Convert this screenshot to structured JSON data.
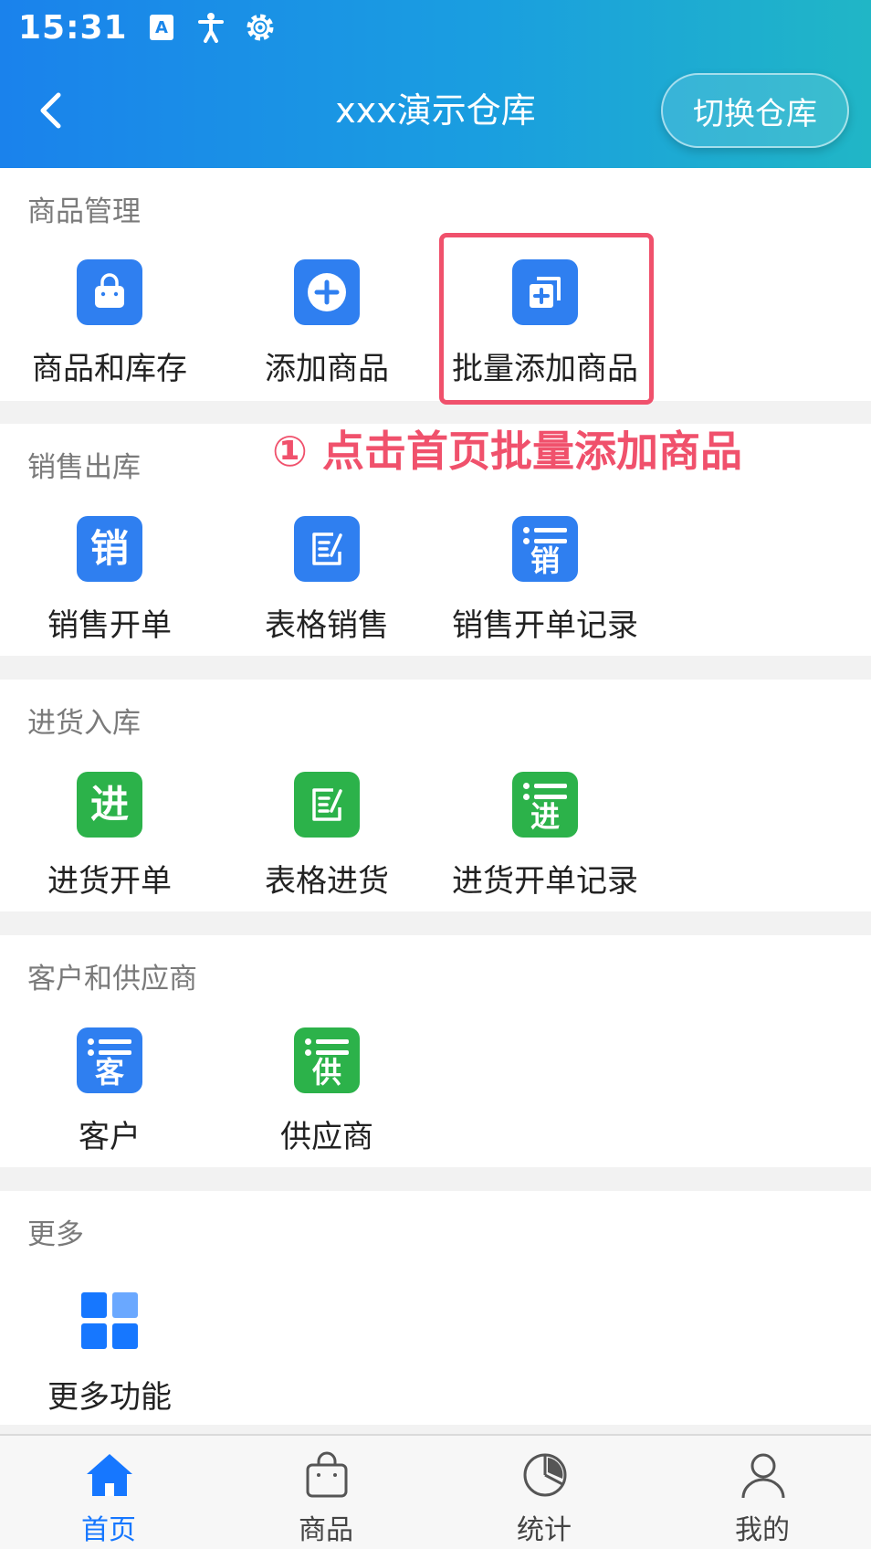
{
  "status_bar": {
    "time": "15:31"
  },
  "header": {
    "title": "xxx演示仓库",
    "switch_label": "切换仓库"
  },
  "sections": [
    {
      "title": "商品管理",
      "items": [
        {
          "label": "商品和库存",
          "icon": "shopping-bag-icon"
        },
        {
          "label": "添加商品",
          "icon": "plus-circle-icon"
        },
        {
          "label": "批量添加商品",
          "icon": "batch-add-icon"
        }
      ]
    },
    {
      "title": "销售出库",
      "items": [
        {
          "label": "销售开单",
          "icon": "sales-icon",
          "glyph": "销"
        },
        {
          "label": "表格销售",
          "icon": "form-edit-icon"
        },
        {
          "label": "销售开单记录",
          "icon": "sales-record-icon",
          "glyph": "销"
        }
      ]
    },
    {
      "title": "进货入库",
      "items": [
        {
          "label": "进货开单",
          "icon": "purchase-icon",
          "glyph": "进"
        },
        {
          "label": "表格进货",
          "icon": "form-edit-icon"
        },
        {
          "label": "进货开单记录",
          "icon": "purchase-record-icon",
          "glyph": "进"
        }
      ]
    },
    {
      "title": "客户和供应商",
      "items": [
        {
          "label": "客户",
          "icon": "customer-list-icon",
          "glyph": "客"
        },
        {
          "label": "供应商",
          "icon": "supplier-list-icon",
          "glyph": "供"
        }
      ]
    },
    {
      "title": "更多",
      "items": [
        {
          "label": "更多功能",
          "icon": "grid-icon"
        }
      ]
    }
  ],
  "annotation": "① 点击首页批量添加商品",
  "tabs": [
    {
      "label": "首页",
      "icon": "home-icon",
      "active": true
    },
    {
      "label": "商品",
      "icon": "bag-icon",
      "active": false
    },
    {
      "label": "统计",
      "icon": "pie-chart-icon",
      "active": false
    },
    {
      "label": "我的",
      "icon": "user-icon",
      "active": false
    }
  ],
  "colors": {
    "accent": "#1677ff",
    "blue_tile": "#2f7ff0",
    "green_tile": "#2cb24a",
    "annotation": "#f0516c"
  }
}
